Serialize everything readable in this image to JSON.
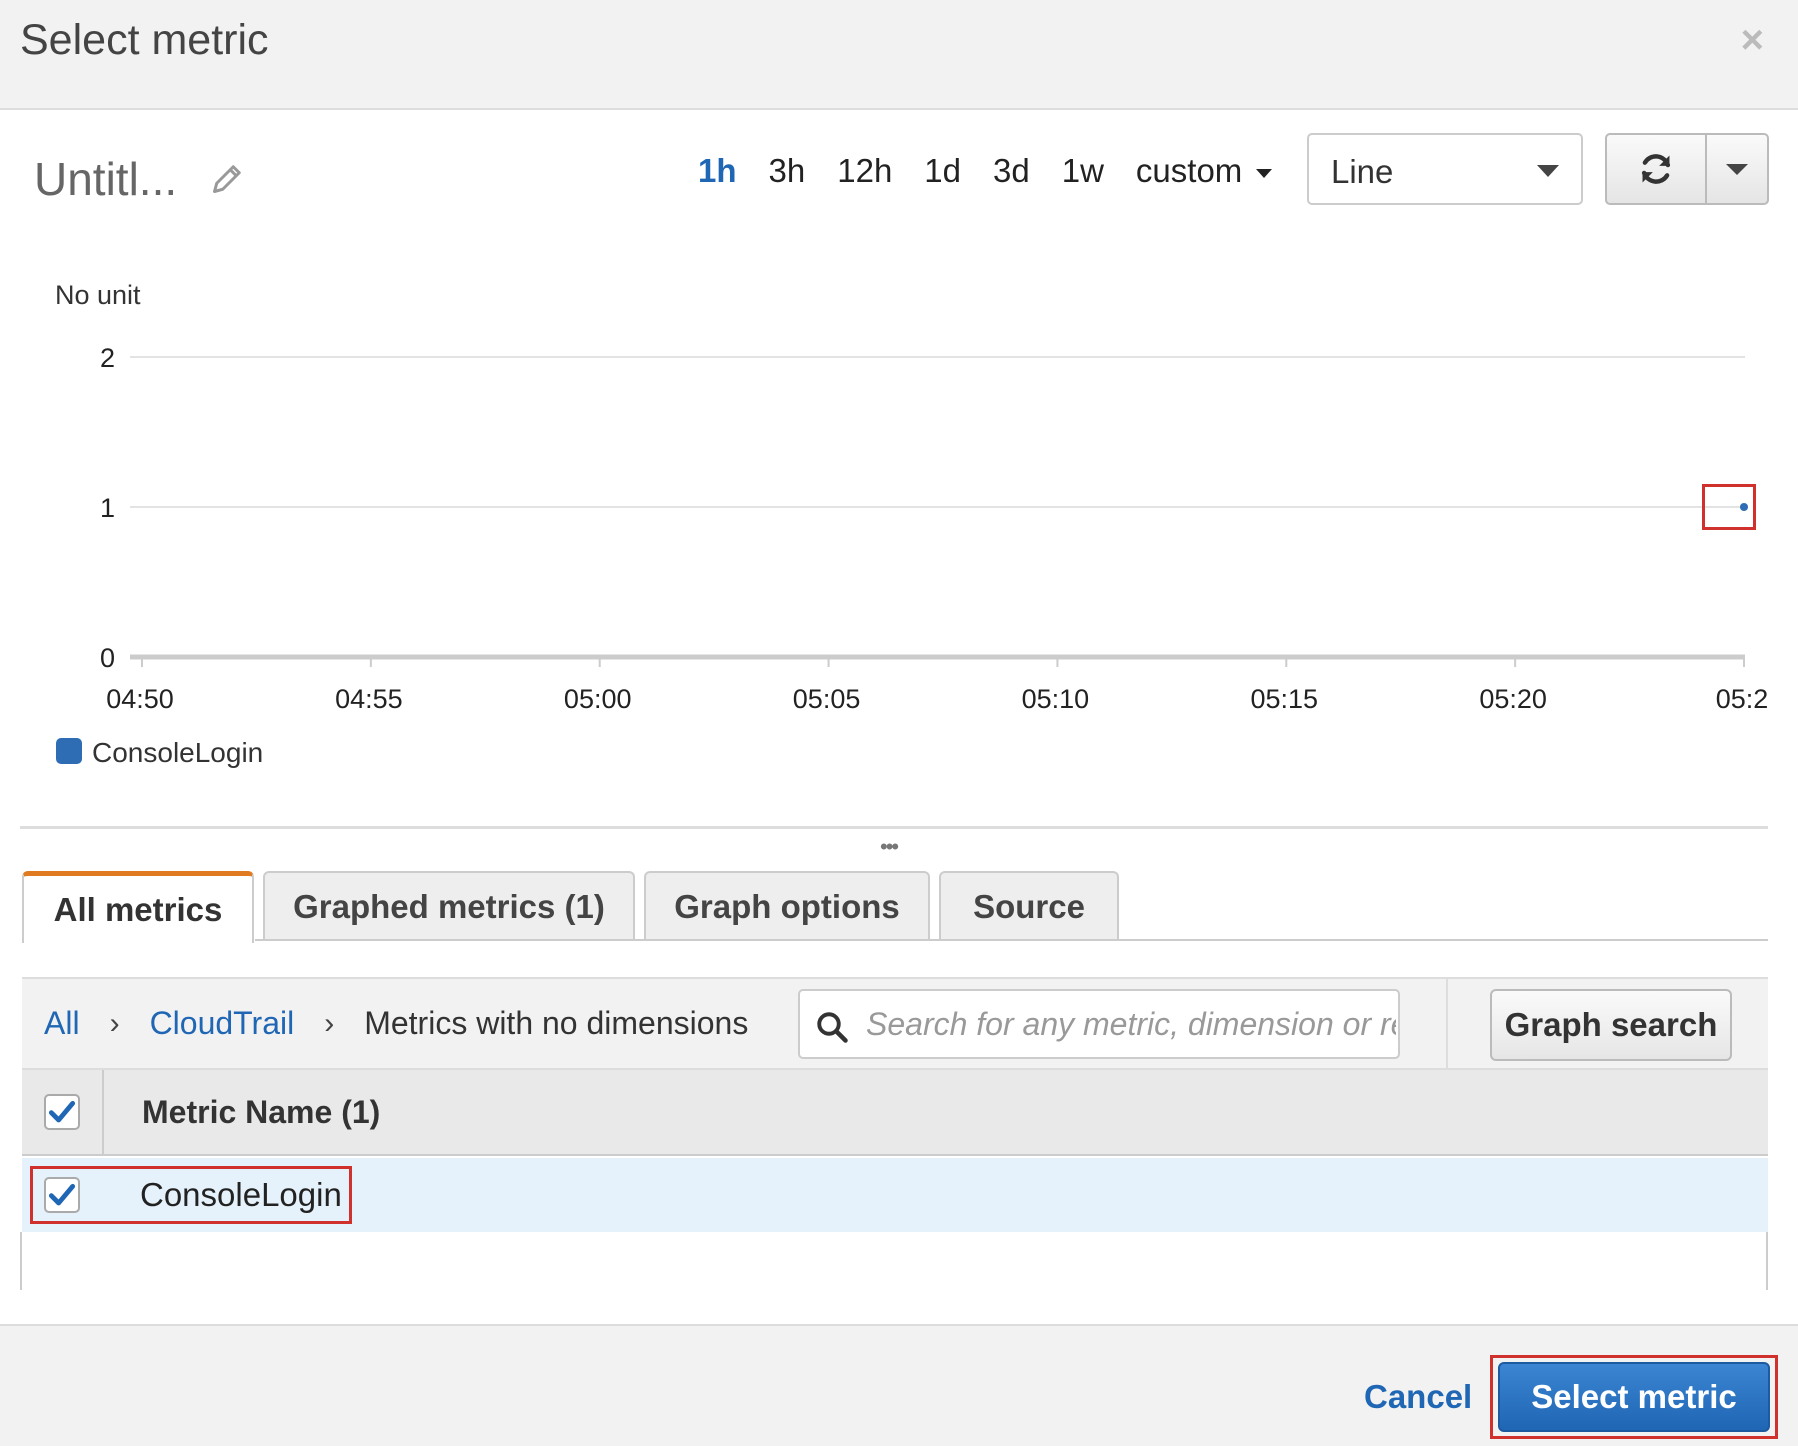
{
  "modal": {
    "title": "Select metric",
    "close_label": "×"
  },
  "graph": {
    "title": "Untitl...",
    "time_ranges": [
      {
        "label": "1h",
        "active": true
      },
      {
        "label": "3h",
        "active": false
      },
      {
        "label": "12h",
        "active": false
      },
      {
        "label": "1d",
        "active": false
      },
      {
        "label": "3d",
        "active": false
      },
      {
        "label": "1w",
        "active": false
      }
    ],
    "custom_label": "custom",
    "chart_type": "Line"
  },
  "chart_data": {
    "type": "line",
    "ylabel": "No unit",
    "ylim": [
      0,
      2
    ],
    "yticks": [
      "2",
      "1",
      "0"
    ],
    "x_ticks": [
      "04:50",
      "04:55",
      "05:00",
      "05:05",
      "05:10",
      "05:15",
      "05:20",
      "05:2"
    ],
    "series": [
      {
        "name": "ConsoleLogin",
        "color": "#2e6db4",
        "points": [
          {
            "x": "05:25",
            "y": 1
          }
        ]
      }
    ],
    "legend_placement": "bottom-left",
    "grid": true
  },
  "tabs": [
    {
      "label": "All metrics",
      "active": true
    },
    {
      "label": "Graphed metrics (1)",
      "active": false
    },
    {
      "label": "Graph options",
      "active": false
    },
    {
      "label": "Source",
      "active": false
    }
  ],
  "breadcrumb": {
    "all": "All",
    "namespace": "CloudTrail",
    "current": "Metrics with no dimensions"
  },
  "search": {
    "placeholder": "Search for any metric, dimension or resource id",
    "value": ""
  },
  "graph_search_label": "Graph search",
  "table": {
    "header": "Metric Name (1)",
    "header_checked": true,
    "rows": [
      {
        "name": "ConsoleLogin",
        "checked": true
      }
    ]
  },
  "footer": {
    "cancel": "Cancel",
    "submit": "Select metric"
  },
  "colors": {
    "accent": "#1f66b4",
    "tab_active": "#e07b22",
    "highlight": "#d0312d"
  }
}
